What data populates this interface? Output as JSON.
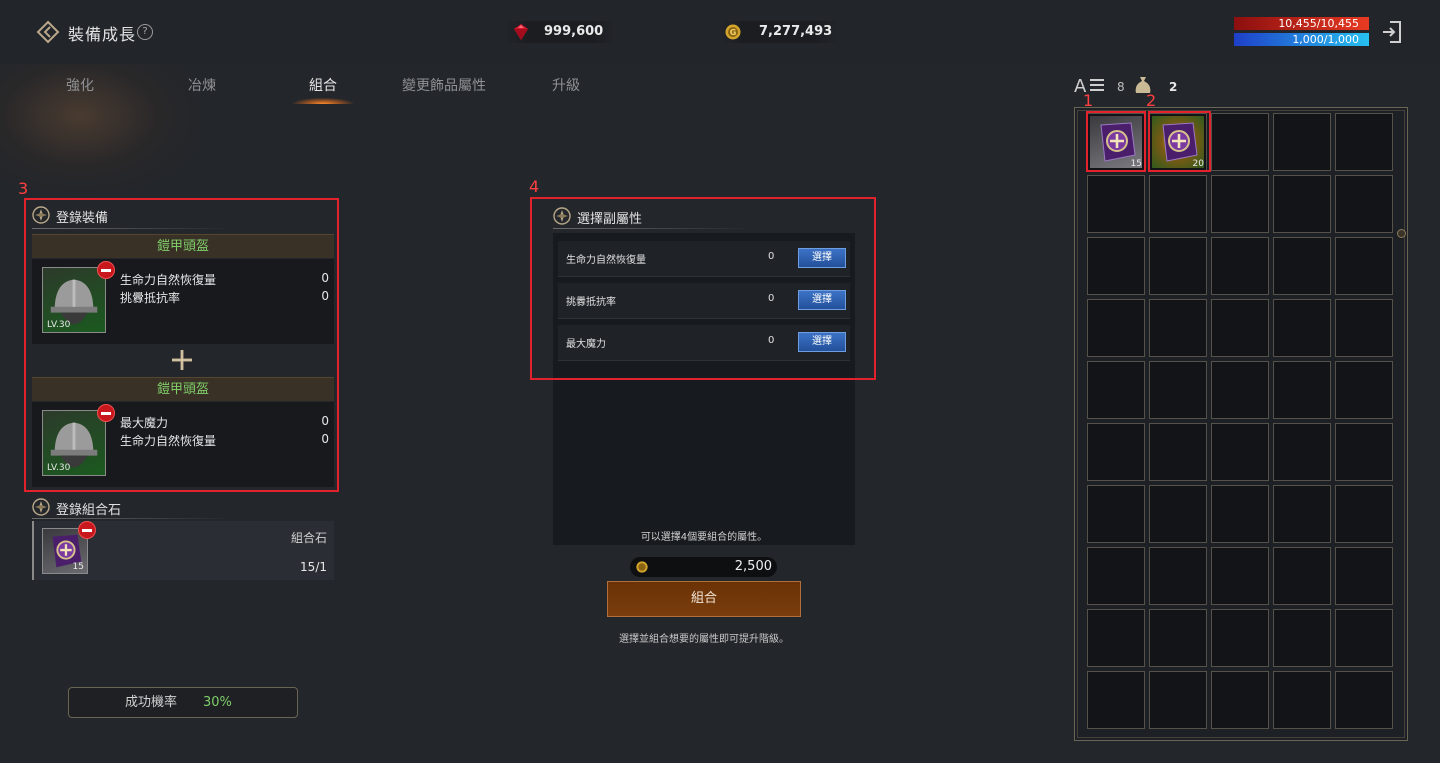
{
  "header": {
    "title": "裝備成長",
    "help_icon": "question-circle-icon",
    "gem_amount": "999,600",
    "gold_amount": "7,277,493",
    "hp_text": "10,455/10,455",
    "mp_text": "1,000/1,000",
    "hp_fill": 1.0,
    "mp_fill": 1.0
  },
  "tabs": [
    {
      "label": "強化",
      "active": false
    },
    {
      "label": "冶煉",
      "active": false
    },
    {
      "label": "組合",
      "active": true
    },
    {
      "label": "變更飾品屬性",
      "active": false
    },
    {
      "label": "升級",
      "active": false
    }
  ],
  "annotations": [
    "1",
    "2",
    "3",
    "4"
  ],
  "register_equipment": {
    "title": "登錄裝備",
    "items": [
      {
        "name": "鎧甲頭盔",
        "level": "LV.30",
        "stats": [
          {
            "name": "生命力自然恢復量",
            "value": "0"
          },
          {
            "name": "挑釁抵抗率",
            "value": "0"
          }
        ]
      },
      {
        "name": "鎧甲頭盔",
        "level": "LV.30",
        "stats": [
          {
            "name": "最大魔力",
            "value": "0"
          },
          {
            "name": "生命力自然恢復量",
            "value": "0"
          }
        ]
      }
    ]
  },
  "register_stone": {
    "title": "登錄組合石",
    "name": "組合石",
    "count": "15",
    "qty": "15/1"
  },
  "success": {
    "label": "成功機率",
    "value": "30%"
  },
  "sub_attributes": {
    "title": "選擇副屬性",
    "select_label": "選擇",
    "rows": [
      {
        "name": "生命力自然恢復量",
        "value": "0"
      },
      {
        "name": "挑釁抵抗率",
        "value": "0"
      },
      {
        "name": "最大魔力",
        "value": "0"
      }
    ],
    "hint": "可以選擇4個要組合的屬性。"
  },
  "cost": {
    "value": "2,500",
    "icon": "gold-coin-icon"
  },
  "combine_button": "組合",
  "combine_hint": "選擇並組合想要的屬性即可提升階級。",
  "inventory": {
    "sort_count": "8",
    "bag_count": "2",
    "slots_shown": 50,
    "items": [
      {
        "slot": 0,
        "icon": "combination-stone-icon",
        "count": "15",
        "rarity": "common"
      },
      {
        "slot": 1,
        "icon": "combination-stone-icon",
        "count": "20",
        "rarity": "rare"
      }
    ]
  },
  "colors": {
    "annotation_red": "#e2222c",
    "stat_green": "#7fce6a",
    "select_blue": "#2f61b4",
    "combine_orange": "#6a3206"
  }
}
